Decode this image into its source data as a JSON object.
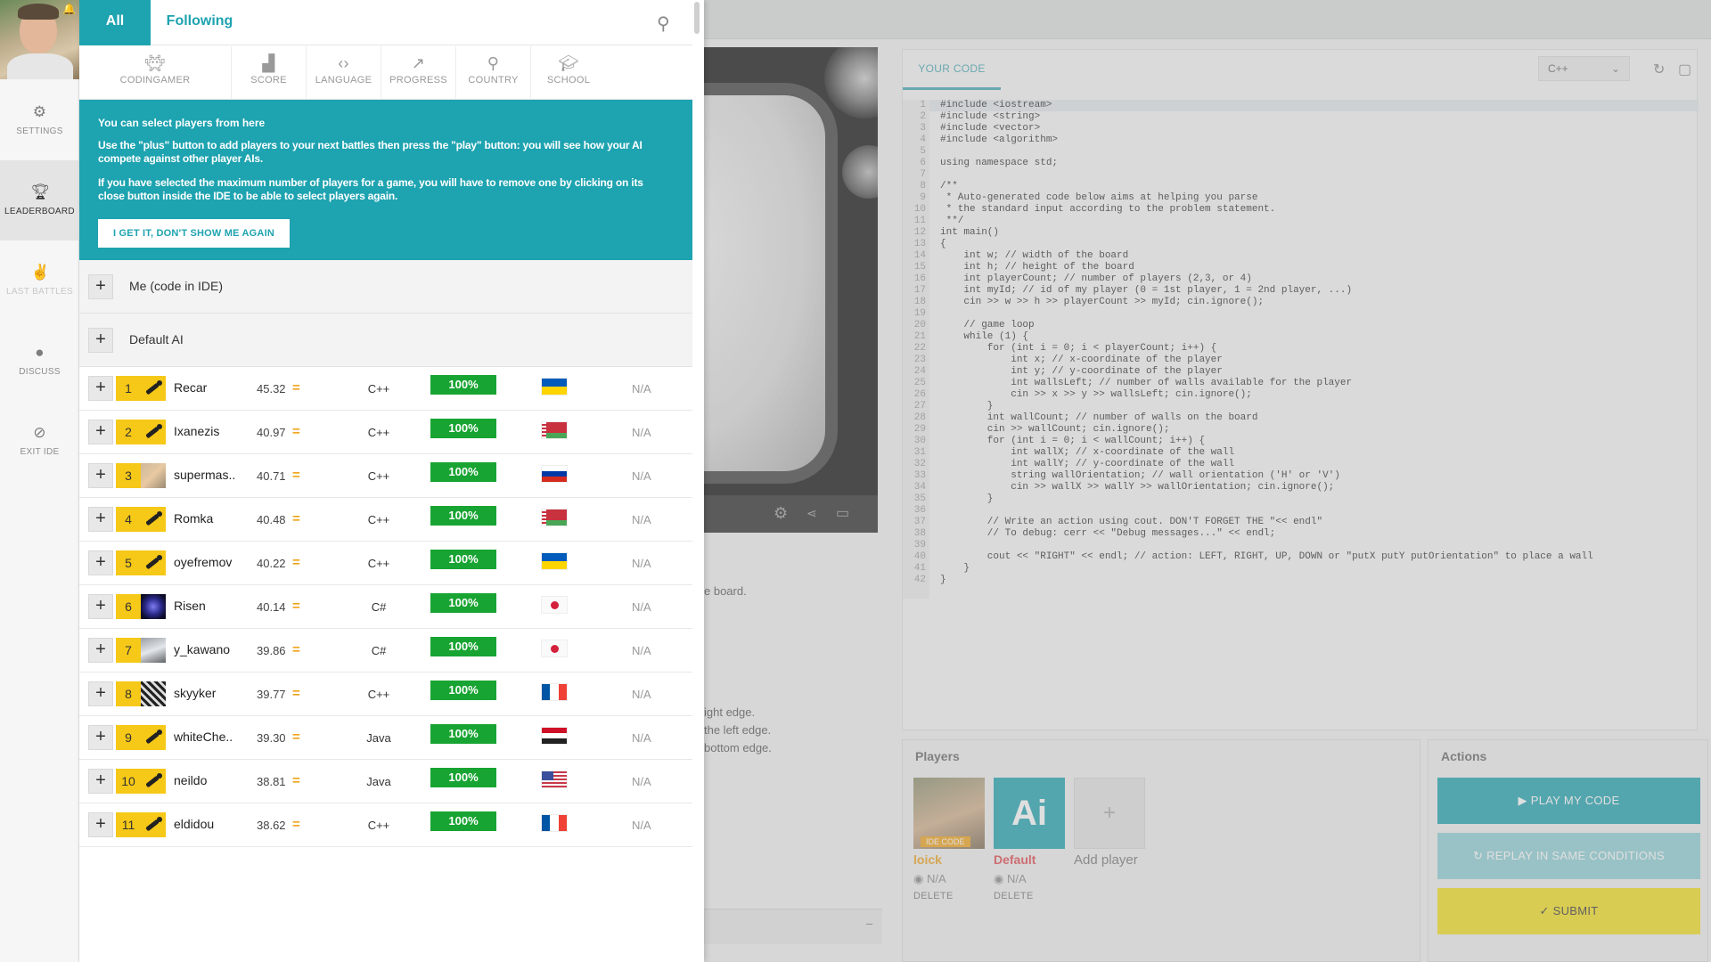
{
  "nav": {
    "items": [
      {
        "label": "SETTINGS",
        "icon": "gear-icon"
      },
      {
        "label": "LEADERBOARD",
        "icon": "trophy-icon"
      },
      {
        "label": "LAST BATTLES",
        "icon": "battles-icon"
      },
      {
        "label": "DISCUSS",
        "icon": "discuss-icon"
      },
      {
        "label": "EXIT IDE",
        "icon": "exit-icon"
      }
    ]
  },
  "leaderboard": {
    "tabs": {
      "all": "All",
      "following": "Following"
    },
    "columns": [
      "CODINGAMER",
      "SCORE",
      "LANGUAGE",
      "PROGRESS",
      "COUNTRY",
      "SCHOOL"
    ],
    "tip": {
      "title": "You can select players from here",
      "p1": "Use the \"plus\" button to add players to your next battles then press the \"play\" button: you will see how your AI compete against other player AIs.",
      "p2": "If you have selected the maximum number of players for a game, you will have to remove one by clicking on its close button inside the IDE to be able to select players again.",
      "button": "I GET IT, DON'T SHOW ME AGAIN"
    },
    "special": [
      "Me (code in IDE)",
      "Default AI"
    ],
    "plus": "+",
    "trend": "=",
    "rows": [
      {
        "rank": "1",
        "name": "Recar",
        "score": "45.32",
        "language": "C++",
        "progress": "100%",
        "country_colors": [
          "#005bbb",
          "#ffd500"
        ],
        "school": "N/A"
      },
      {
        "rank": "2",
        "name": "Ixanezis",
        "score": "40.97",
        "language": "C++",
        "progress": "100%",
        "country_colors": [
          "#c8313e",
          "#4aa657"
        ],
        "school": "N/A"
      },
      {
        "rank": "3",
        "name": "supermas..",
        "score": "40.71",
        "language": "C++",
        "progress": "100%",
        "country_colors": [
          "#ffffff",
          "#0039a6",
          "#d52b1e"
        ],
        "school": "N/A"
      },
      {
        "rank": "4",
        "name": "Romka",
        "score": "40.48",
        "language": "C++",
        "progress": "100%",
        "country_colors": [
          "#c8313e",
          "#4aa657"
        ],
        "school": "N/A"
      },
      {
        "rank": "5",
        "name": "oyefremov",
        "score": "40.22",
        "language": "C++",
        "progress": "100%",
        "country_colors": [
          "#005bbb",
          "#ffd500"
        ],
        "school": "N/A"
      },
      {
        "rank": "6",
        "name": "Risen",
        "score": "40.14",
        "language": "C#",
        "progress": "100%",
        "country_colors": [
          "#ffffff",
          "#d3203b"
        ],
        "school": "N/A"
      },
      {
        "rank": "7",
        "name": "y_kawano",
        "score": "39.86",
        "language": "C#",
        "progress": "100%",
        "country_colors": [
          "#ffffff",
          "#d3203b"
        ],
        "school": "N/A"
      },
      {
        "rank": "8",
        "name": "skyyker",
        "score": "39.77",
        "language": "C++",
        "progress": "100%",
        "country_colors": [
          "#0055a4",
          "#ffffff",
          "#ef4135"
        ],
        "school": "N/A"
      },
      {
        "rank": "9",
        "name": "whiteChe..",
        "score": "39.30",
        "language": "Java",
        "progress": "100%",
        "country_colors": [
          "#ce1126",
          "#ffffff",
          "#222222"
        ],
        "school": "N/A"
      },
      {
        "rank": "10",
        "name": "neildo",
        "score": "38.81",
        "language": "Java",
        "progress": "100%",
        "country_colors": [
          "#b22234",
          "#ffffff",
          "#3c3b6e"
        ],
        "school": "N/A"
      },
      {
        "rank": "11",
        "name": "eldidou",
        "score": "38.62",
        "language": "C++",
        "progress": "100%",
        "country_colors": [
          "#0055a4",
          "#ffffff",
          "#ef4135"
        ],
        "school": "N/A"
      }
    ]
  },
  "ide": {
    "editor_tab": "YOUR CODE",
    "language": "C++",
    "code_lines": [
      "#include <iostream>",
      "#include <string>",
      "#include <vector>",
      "#include <algorithm>",
      "",
      "using namespace std;",
      "",
      "/**",
      " * Auto-generated code below aims at helping you parse",
      " * the standard input according to the problem statement.",
      " **/",
      "int main()",
      "{",
      "    int w; // width of the board",
      "    int h; // height of the board",
      "    int playerCount; // number of players (2,3, or 4)",
      "    int myId; // id of my player (0 = 1st player, 1 = 2nd player, ...)",
      "    cin >> w >> h >> playerCount >> myId; cin.ignore();",
      "",
      "    // game loop",
      "    while (1) {",
      "        for (int i = 0; i < playerCount; i++) {",
      "            int x; // x-coordinate of the player",
      "            int y; // y-coordinate of the player",
      "            int wallsLeft; // number of walls available for the player",
      "            cin >> x >> y >> wallsLeft; cin.ignore();",
      "        }",
      "        int wallCount; // number of walls on the board",
      "        cin >> wallCount; cin.ignore();",
      "        for (int i = 0; i < wallCount; i++) {",
      "            int wallX; // x-coordinate of the wall",
      "            int wallY; // y-coordinate of the wall",
      "            string wallOrientation; // wall orientation ('H' or 'V')",
      "            cin >> wallX >> wallY >> wallOrientation; cin.ignore();",
      "        }",
      "",
      "        // Write an action using cout. DON'T FORGET THE \"<< endl\"",
      "        // To debug: cerr << \"Debug messages...\" << endl;",
      "",
      "        cout << \"RIGHT\" << endl; // action: LEFT, RIGHT, UP, DOWN or \"putX putY putOrientation\" to place a wall",
      "    }",
      "}"
    ],
    "statement": {
      "line1": "e board.",
      "line2": "ight edge.",
      "line3": "the left edge.",
      "line4": "bottom edge."
    },
    "players": {
      "title": "Players",
      "cards": [
        {
          "name": "loick",
          "badge": "IDE CODE",
          "rank": "N/A",
          "delete": "DELETE",
          "color": "#f0a41b"
        },
        {
          "name": "Default",
          "badge": "Ai",
          "rank": "N/A",
          "delete": "DELETE",
          "color": "#e2474e"
        }
      ],
      "add_label": "Add player",
      "add_symbol": "+"
    },
    "actions": {
      "title": "Actions",
      "play": "PLAY MY CODE",
      "replay": "REPLAY IN SAME CONDITIONS",
      "submit": "SUBMIT"
    }
  }
}
